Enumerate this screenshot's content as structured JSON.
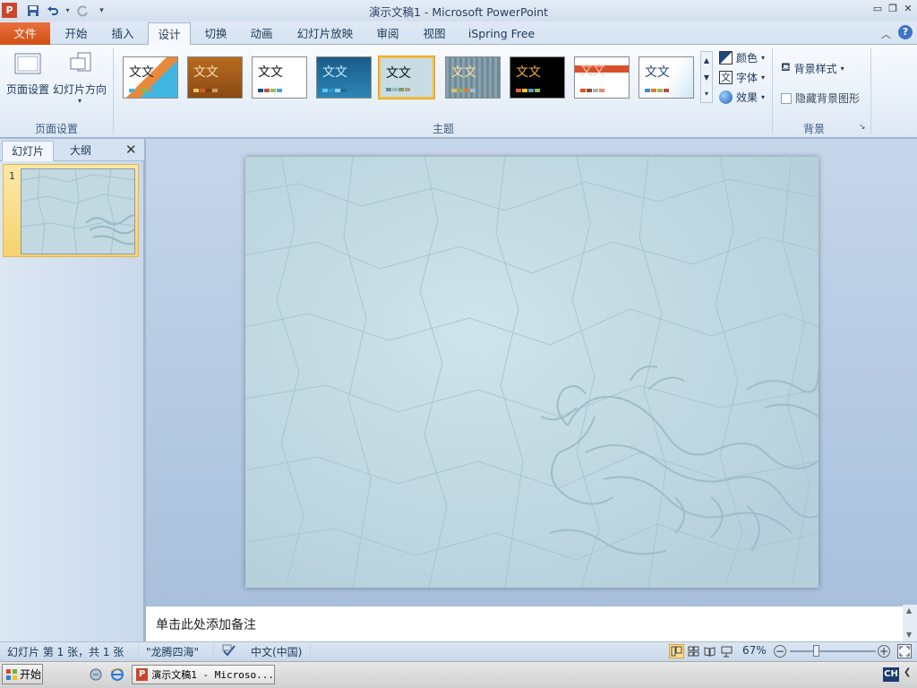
{
  "window": {
    "title": "演示文稿1 - Microsoft PowerPoint"
  },
  "tabs": [
    "文件",
    "开始",
    "插入",
    "设计",
    "切换",
    "动画",
    "幻灯片放映",
    "审阅",
    "视图",
    "iSpring Free"
  ],
  "ribbon": {
    "page_setup": {
      "btn1": "页面设置",
      "btn2": "幻灯片方向",
      "group": "页面设置"
    },
    "themes": {
      "group": "主题",
      "sample": "文文"
    },
    "theme_options": {
      "colors": "颜色",
      "fonts": "字体",
      "effects": "效果"
    },
    "background": {
      "styles": "背景样式",
      "hide": "隐藏背景图形",
      "group": "背景"
    }
  },
  "left_pane": {
    "tab1": "幻灯片",
    "tab2": "大纲",
    "slide_number": "1"
  },
  "notes": {
    "placeholder": "单击此处添加备注"
  },
  "status": {
    "slide_info": "幻灯片 第 1 张，共 1 张",
    "theme_name": "\"龙腾四海\"",
    "language": "中文(中国)",
    "zoom": "67%"
  },
  "taskbar": {
    "start": "开始",
    "app": "演示文稿1 - Microso...",
    "ime": "CH"
  }
}
